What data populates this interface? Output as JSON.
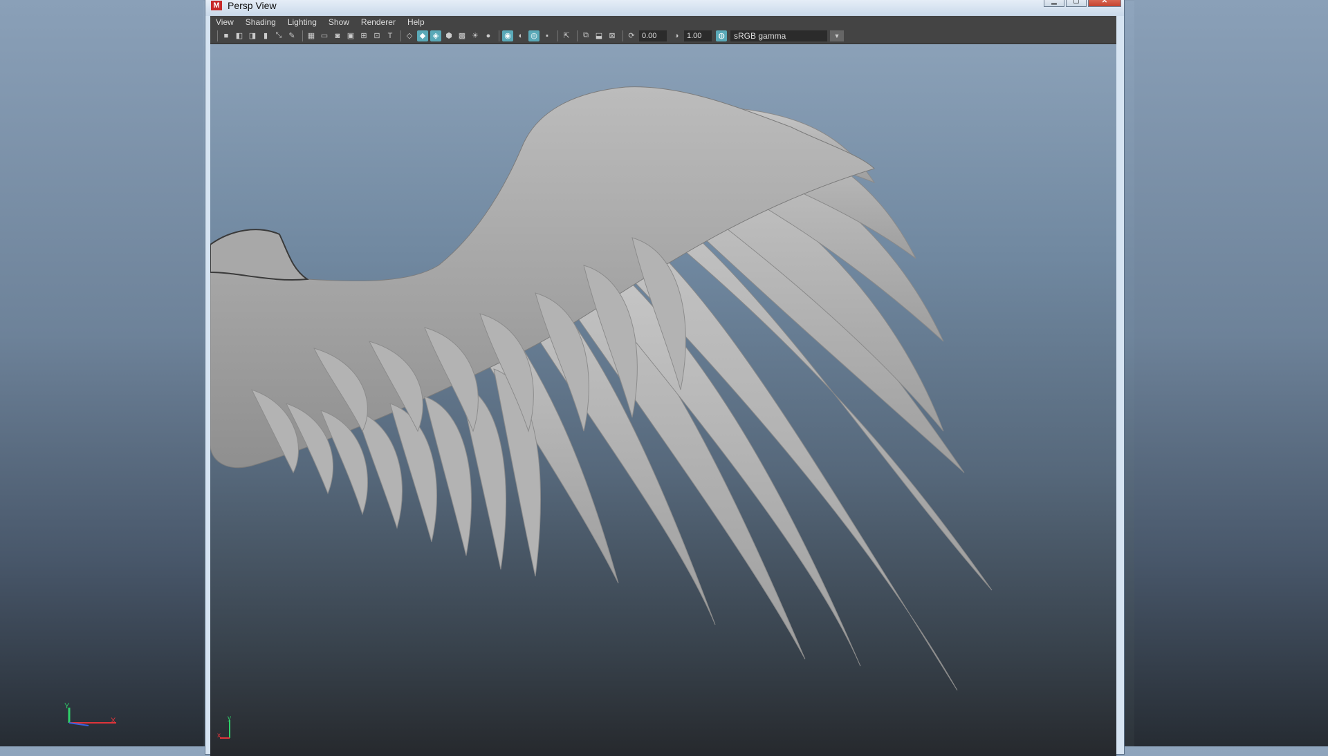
{
  "window": {
    "title": "Persp View",
    "app_icon": "M",
    "controls": [
      "minimize-icon",
      "maximize-icon",
      "close-icon"
    ]
  },
  "menubar": {
    "items": [
      "View",
      "Shading",
      "Lighting",
      "Show",
      "Renderer",
      "Help"
    ]
  },
  "toolbar": {
    "exposure_value": "0.00",
    "gamma_value": "1.00",
    "color_space": "sRGB gamma"
  },
  "viewport": {
    "camera": "persp",
    "axis_labels": {
      "x": "x",
      "y": "y"
    }
  },
  "colors": {
    "accent": "#5aa9b8",
    "toolbar_bg": "#444444",
    "wing": "#b4b4b4"
  }
}
